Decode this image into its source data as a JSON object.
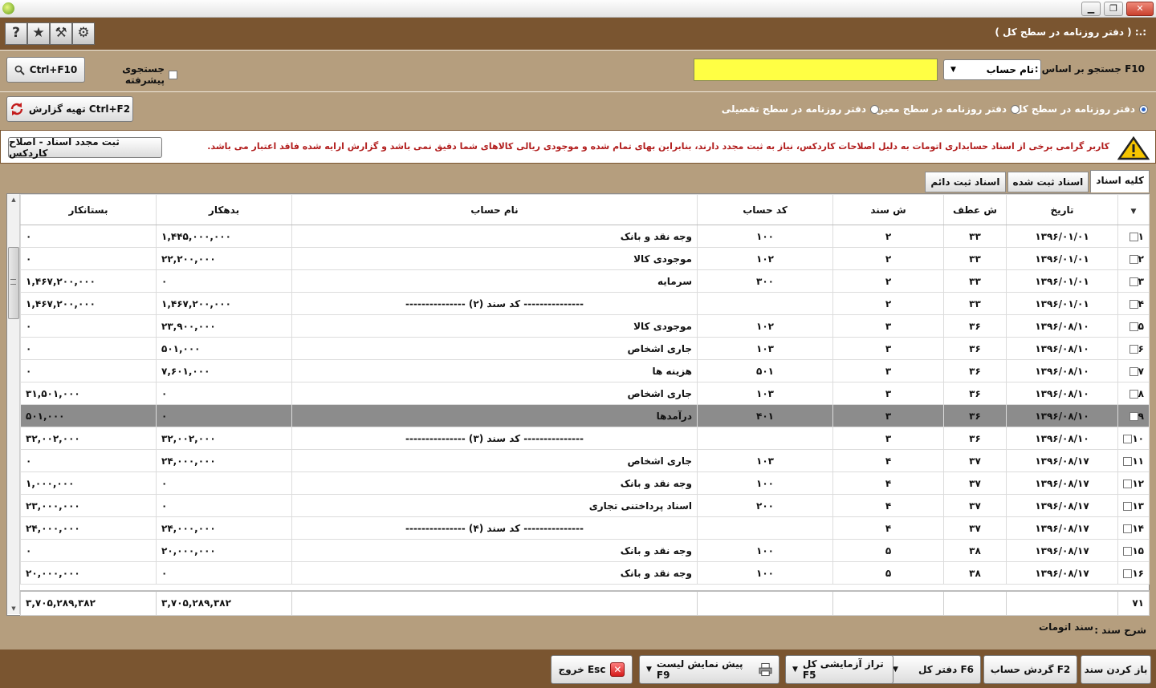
{
  "window": {
    "title": ":.: ( دفتر روزنامه در سطح کل )",
    "controls": {
      "minimize": "▁",
      "maximize": "❐",
      "close": "✕"
    }
  },
  "toolbar": {
    "icons": [
      "settings-icon",
      "tools-icon",
      "star-icon",
      "help-icon"
    ],
    "glyphs": {
      "settings": "⚙",
      "tools": "⚒",
      "star": "★",
      "help": "?"
    }
  },
  "search": {
    "label": "F10 جستجو بر اساس :",
    "select_value": "نام حساب",
    "input_value": "",
    "advanced_label": "جستجوی پیشرفته",
    "button_label": "Ctrl+F10"
  },
  "levels": {
    "general": "دفتر روزنامه در سطح کل",
    "moeen": "دفتر روزنامه در سطح معین",
    "tafsili": "دفتر روزنامه در سطح تفصیلی",
    "selected": "general",
    "report_button": "تهیه گزارش Ctrl+F2"
  },
  "warning": {
    "text": "کاربر گرامی برخی از اسناد حسابداری اتومات به دلیل اصلاحات کاردکس، نیاز به ثبت مجدد دارند، بنابراین بهای تمام شده و موجودی ریالی کالاهای شما دقیق نمی باشد و گزارش ارایه شده فاقد اعتبار می باشد.",
    "button": "ثبت مجدد اسناد - اصلاح کاردکس"
  },
  "tabs": [
    {
      "label": "کلیه اسناد",
      "active": true
    },
    {
      "label": "اسناد ثبت شده",
      "active": false
    },
    {
      "label": "اسناد ثبت دائم",
      "active": false
    }
  ],
  "table": {
    "columns": {
      "creditor": "بستانکار",
      "debtor": "بدهکار",
      "account_name": "نام حساب",
      "account_code": "کد حساب",
      "doc_no": "ش سند",
      "ref_no": "ش عطف",
      "date": "تاریخ"
    },
    "rows": [
      {
        "n": "۱",
        "date": "۱۳۹۶/۰۱/۰۱",
        "ref": "۳۳",
        "doc": "۲",
        "code": "۱۰۰",
        "name": "وجه نقد و بانک",
        "debtor": "۱,۴۴۵,۰۰۰,۰۰۰",
        "creditor": "۰"
      },
      {
        "n": "۲",
        "date": "۱۳۹۶/۰۱/۰۱",
        "ref": "۳۳",
        "doc": "۲",
        "code": "۱۰۲",
        "name": "موجودی کالا",
        "debtor": "۲۲,۲۰۰,۰۰۰",
        "creditor": "۰"
      },
      {
        "n": "۳",
        "date": "۱۳۹۶/۰۱/۰۱",
        "ref": "۳۳",
        "doc": "۲",
        "code": "۳۰۰",
        "name": "سرمایه",
        "debtor": "۰",
        "creditor": "۱,۴۶۷,۲۰۰,۰۰۰"
      },
      {
        "n": "۴",
        "date": "۱۳۹۶/۰۱/۰۱",
        "ref": "۳۳",
        "doc": "۲",
        "code": "",
        "name": "--------------- کد سند (۲) ---------------",
        "debtor": "۱,۴۶۷,۲۰۰,۰۰۰",
        "creditor": "۱,۴۶۷,۲۰۰,۰۰۰",
        "summary": true
      },
      {
        "n": "۵",
        "date": "۱۳۹۶/۰۸/۱۰",
        "ref": "۳۶",
        "doc": "۳",
        "code": "۱۰۲",
        "name": "موجودی کالا",
        "debtor": "۲۳,۹۰۰,۰۰۰",
        "creditor": "۰"
      },
      {
        "n": "۶",
        "date": "۱۳۹۶/۰۸/۱۰",
        "ref": "۳۶",
        "doc": "۳",
        "code": "۱۰۳",
        "name": "جاری اشخاص",
        "debtor": "۵۰۱,۰۰۰",
        "creditor": "۰"
      },
      {
        "n": "۷",
        "date": "۱۳۹۶/۰۸/۱۰",
        "ref": "۳۶",
        "doc": "۳",
        "code": "۵۰۱",
        "name": "هزینه ها",
        "debtor": "۷,۶۰۱,۰۰۰",
        "creditor": "۰"
      },
      {
        "n": "۸",
        "date": "۱۳۹۶/۰۸/۱۰",
        "ref": "۳۶",
        "doc": "۳",
        "code": "۱۰۳",
        "name": "جاری اشخاص",
        "debtor": "۰",
        "creditor": "۳۱,۵۰۱,۰۰۰"
      },
      {
        "n": "۹",
        "date": "۱۳۹۶/۰۸/۱۰",
        "ref": "۳۶",
        "doc": "۳",
        "code": "۴۰۱",
        "name": "درآمدها",
        "debtor": "۰",
        "creditor": "۵۰۱,۰۰۰",
        "selected": true
      },
      {
        "n": "۱۰",
        "date": "۱۳۹۶/۰۸/۱۰",
        "ref": "۳۶",
        "doc": "۳",
        "code": "",
        "name": "--------------- کد سند (۳) ---------------",
        "debtor": "۳۲,۰۰۲,۰۰۰",
        "creditor": "۳۲,۰۰۲,۰۰۰",
        "summary": true
      },
      {
        "n": "۱۱",
        "date": "۱۳۹۶/۰۸/۱۷",
        "ref": "۳۷",
        "doc": "۴",
        "code": "۱۰۳",
        "name": "جاری اشخاص",
        "debtor": "۲۴,۰۰۰,۰۰۰",
        "creditor": "۰"
      },
      {
        "n": "۱۲",
        "date": "۱۳۹۶/۰۸/۱۷",
        "ref": "۳۷",
        "doc": "۴",
        "code": "۱۰۰",
        "name": "وجه نقد و بانک",
        "debtor": "۰",
        "creditor": "۱,۰۰۰,۰۰۰"
      },
      {
        "n": "۱۳",
        "date": "۱۳۹۶/۰۸/۱۷",
        "ref": "۳۷",
        "doc": "۴",
        "code": "۲۰۰",
        "name": "اسناد پرداختنی تجاری",
        "debtor": "۰",
        "creditor": "۲۳,۰۰۰,۰۰۰"
      },
      {
        "n": "۱۴",
        "date": "۱۳۹۶/۰۸/۱۷",
        "ref": "۳۷",
        "doc": "۴",
        "code": "",
        "name": "--------------- کد سند (۴) ---------------",
        "debtor": "۲۴,۰۰۰,۰۰۰",
        "creditor": "۲۴,۰۰۰,۰۰۰",
        "summary": true
      },
      {
        "n": "۱۵",
        "date": "۱۳۹۶/۰۸/۱۷",
        "ref": "۳۸",
        "doc": "۵",
        "code": "۱۰۰",
        "name": "وجه نقد و بانک",
        "debtor": "۲۰,۰۰۰,۰۰۰",
        "creditor": "۰"
      },
      {
        "n": "۱۶",
        "date": "۱۳۹۶/۰۸/۱۷",
        "ref": "۳۸",
        "doc": "۵",
        "code": "۱۰۰",
        "name": "وجه نقد و بانک",
        "debtor": "۰",
        "creditor": "۲۰,۰۰۰,۰۰۰"
      }
    ],
    "totals": {
      "count": "۷۱",
      "debtor": "۳,۷۰۵,۲۸۹,۳۸۲",
      "creditor": "۳,۷۰۵,۲۸۹,۳۸۲"
    }
  },
  "description": {
    "label": "شرح سند :",
    "value": "سند اتومات"
  },
  "bottom_buttons": {
    "open_doc": "باز کردن سند",
    "account_flow": "گردش حساب F2",
    "ledger": "دفتر کل F6",
    "trial_balance": "تراز آزمایشی کل F5",
    "print_preview": "پیش نمایش لیست F9",
    "exit": "خروج Esc"
  },
  "colors": {
    "brown": "#7a5530",
    "beige": "#b59e7e",
    "search_yellow": "#ffff44",
    "warning_red": "#b21e1e",
    "selected_row": "#8c8c8c"
  }
}
